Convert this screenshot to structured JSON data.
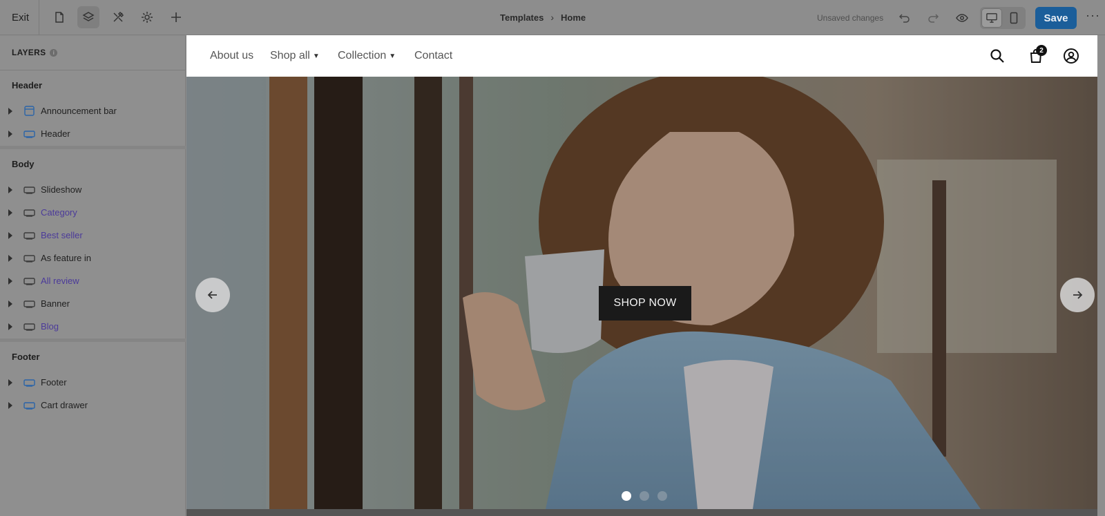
{
  "topbar": {
    "exit_label": "Exit",
    "breadcrumb": [
      "Templates",
      "Home"
    ],
    "status": "Unsaved changes",
    "save_label": "Save",
    "more_label": "···",
    "tools": [
      "pages-icon",
      "layers-icon",
      "theme-styles-icon",
      "settings-icon",
      "add-icon"
    ]
  },
  "panel": {
    "title": "LAYERS",
    "groups": [
      {
        "label": "Header",
        "items": [
          {
            "label": "Announcement bar",
            "icon": "announcement-icon"
          },
          {
            "label": "Header",
            "icon": "section-icon"
          }
        ]
      },
      {
        "label": "Body",
        "items": [
          {
            "label": "Slideshow",
            "icon": "section-icon"
          },
          {
            "label": "Category",
            "icon": "section-icon"
          },
          {
            "label": "Best seller",
            "icon": "section-icon"
          },
          {
            "label": "As feature in",
            "icon": "section-icon"
          },
          {
            "label": "All review",
            "icon": "section-icon"
          },
          {
            "label": "Banner",
            "icon": "section-icon"
          },
          {
            "label": "Blog",
            "icon": "section-icon"
          }
        ]
      },
      {
        "label": "Footer",
        "items": [
          {
            "label": "Footer",
            "icon": "section-icon"
          },
          {
            "label": "Cart drawer",
            "icon": "section-icon"
          }
        ]
      }
    ]
  },
  "store": {
    "nav": [
      "About us",
      "Shop all",
      "Collection",
      "Contact"
    ],
    "cart_count": "2",
    "hero": {
      "cta": "SHOP NOW",
      "slides": 3,
      "active_slide": 1
    }
  },
  "colors": {
    "save_button": "#1b5e9a",
    "link_purple": "#4b3a9a",
    "cta_bg": "#1a1a1a"
  }
}
